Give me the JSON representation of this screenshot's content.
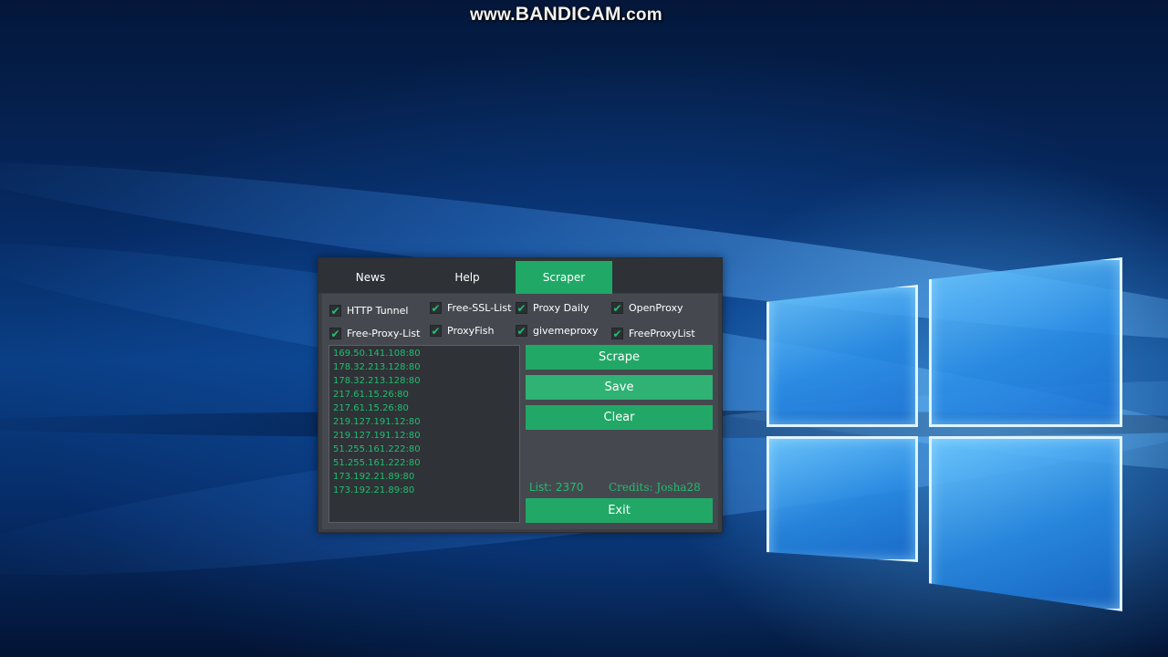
{
  "watermark": {
    "prefix": "www.",
    "brand": "BANDICAM",
    "suffix": ".com"
  },
  "app": {
    "tabs": [
      {
        "label": "News",
        "active": false
      },
      {
        "label": "Help",
        "active": false
      },
      {
        "label": "Scraper",
        "active": true
      }
    ],
    "sources": [
      {
        "label": "HTTP Tunnel",
        "checked": true
      },
      {
        "label": "Free-SSL-List",
        "checked": true
      },
      {
        "label": "Proxy Daily",
        "checked": true
      },
      {
        "label": "OpenProxy",
        "checked": true
      },
      {
        "label": "Free-Proxy-List",
        "checked": true
      },
      {
        "label": "ProxyFish",
        "checked": true
      },
      {
        "label": "givemeproxy",
        "checked": true
      },
      {
        "label": "FreeProxyList",
        "checked": true
      }
    ],
    "proxies": [
      "169.50.141.108:80",
      "178.32.213.128:80",
      "178.32.213.128:80",
      "217.61.15.26:80",
      "217.61.15.26:80",
      "219.127.191.12:80",
      "219.127.191.12:80",
      "51.255.161.222:80",
      "51.255.161.222:80",
      "173.192.21.89:80",
      "173.192.21.89:80"
    ],
    "buttons": {
      "scrape": "Scrape",
      "save": "Save",
      "clear": "Clear",
      "exit": "Exit"
    },
    "status": {
      "list": "List:  2370",
      "credits": "Credits: Josha28"
    },
    "colors": {
      "accent": "#21a866",
      "text_green": "#1fbf6e",
      "window_bg": "#3a3d42"
    }
  }
}
